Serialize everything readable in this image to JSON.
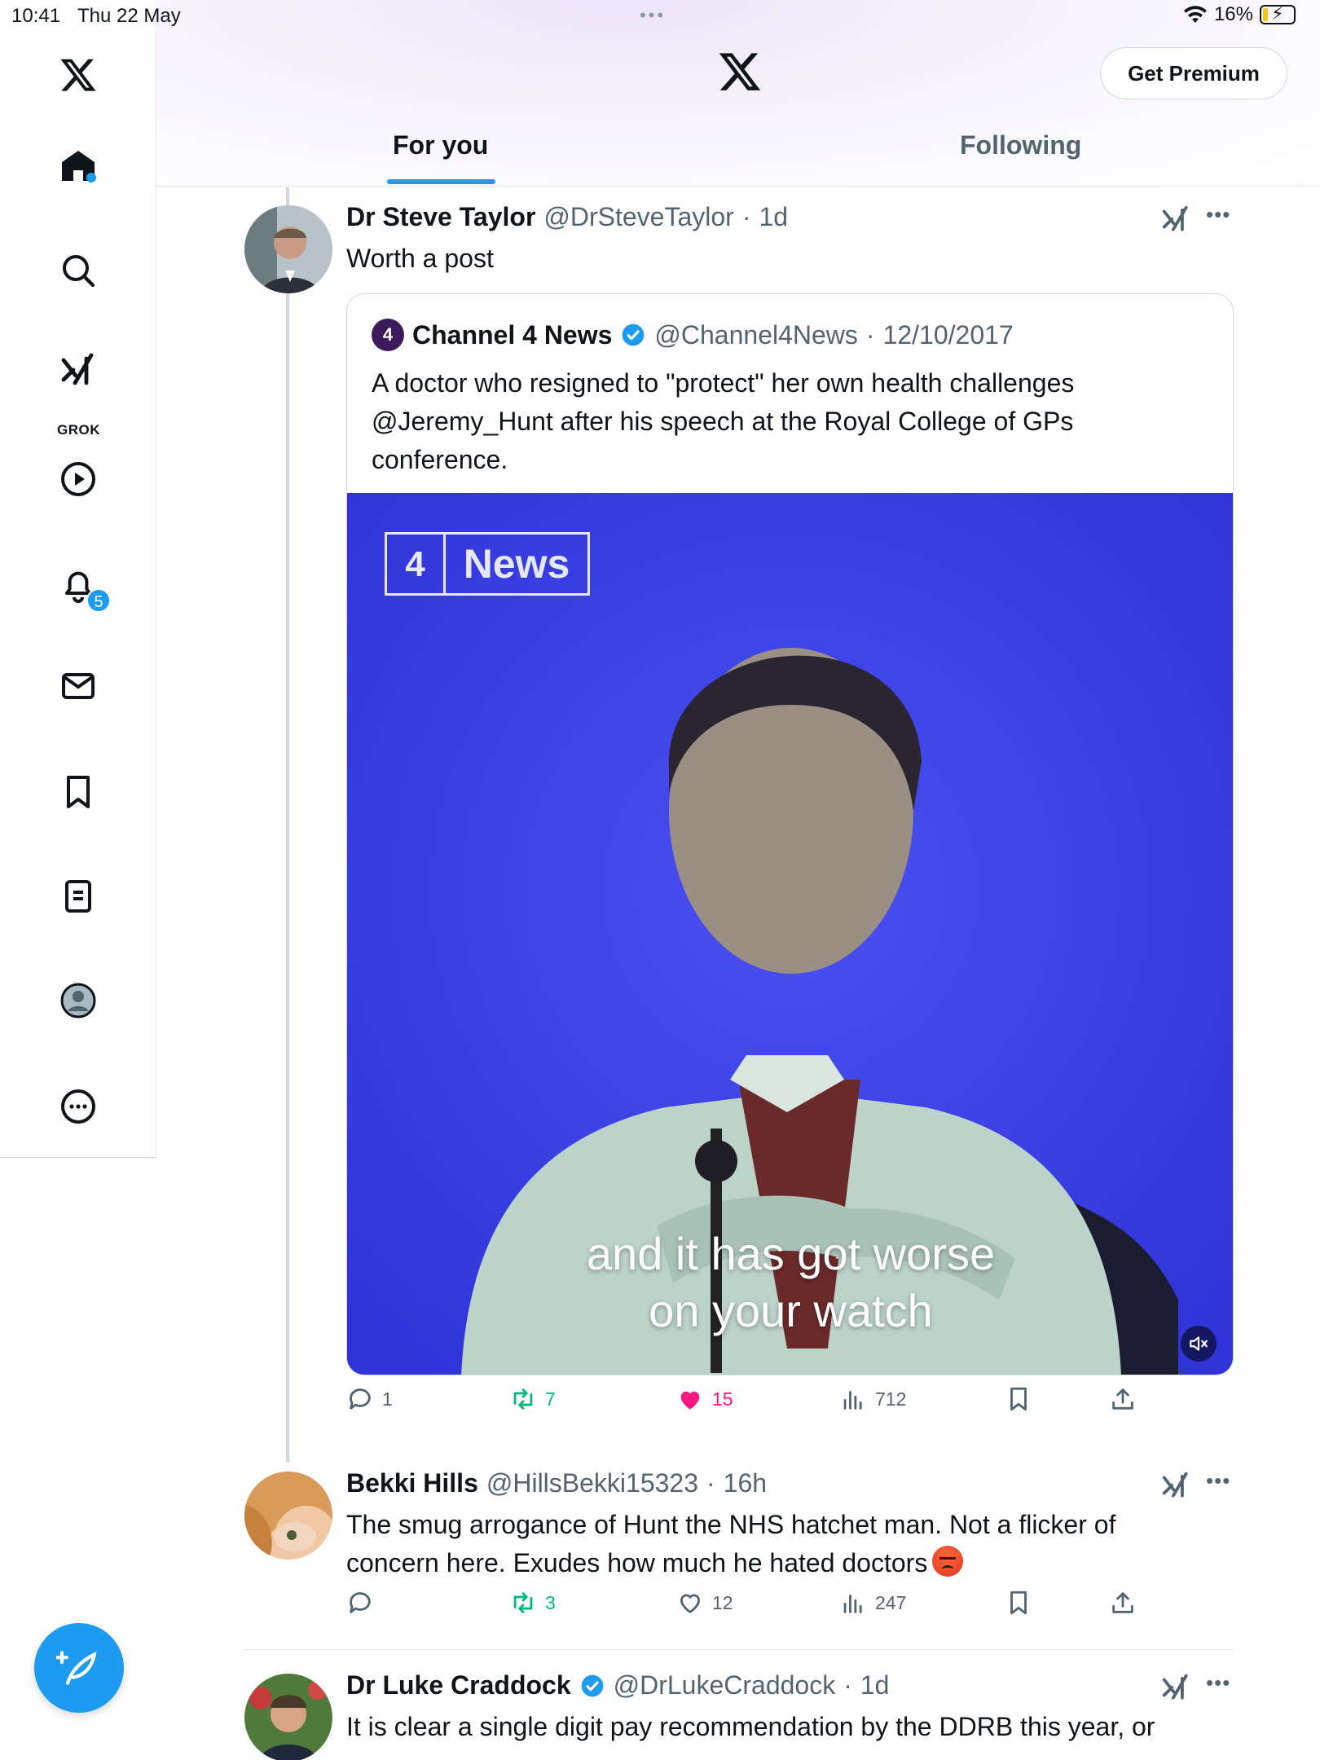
{
  "status_bar": {
    "time": "10:41",
    "date": "Thu 22 May",
    "battery": "16%"
  },
  "header": {
    "premium_label": "Get Premium",
    "tabs": [
      {
        "label": "For you",
        "active": true
      },
      {
        "label": "Following",
        "active": false
      }
    ]
  },
  "sidebar": {
    "grok_label": "GROK",
    "notifications_badge": "5"
  },
  "tweets": [
    {
      "name": "Dr Steve Taylor",
      "handle": "@DrSteveTaylor",
      "sep": "·",
      "time": "1d",
      "text": "Worth a post",
      "quote": {
        "avatar_text": "4",
        "name": "Channel 4 News",
        "verified": true,
        "handle": "@Channel4News",
        "sep": "·",
        "time": "12/10/2017",
        "text": "A doctor who resigned to \"protect\" her own health challenges @Jeremy_Hunt after his speech at the Royal College of GPs conference.",
        "media": {
          "logo_four": "4",
          "logo_text": "News",
          "caption_line1": "and it has got worse",
          "caption_line2": "on your watch"
        }
      },
      "stats": {
        "replies": "1",
        "reposts": "7",
        "likes": "15",
        "views": "712"
      }
    },
    {
      "name": "Bekki Hills",
      "handle": "@HillsBekki15323",
      "sep": "·",
      "time": "16h",
      "text": "The smug arrogance of Hunt the NHS hatchet man. Not a flicker of concern here. Exudes how much he hated doctors",
      "stats": {
        "replies": "",
        "reposts": "3",
        "likes": "12",
        "views": "247"
      }
    },
    {
      "name": "Dr Luke Craddock",
      "verified": true,
      "handle": "@DrLukeCraddock",
      "sep": "·",
      "time": "1d",
      "text": "It is clear a single digit pay recommendation by the DDRB this year, or"
    }
  ],
  "colors": {
    "accent": "#1d9bf0",
    "repost": "#00ba7c",
    "like": "#f91880",
    "media_bg": "#3a3fe6"
  }
}
